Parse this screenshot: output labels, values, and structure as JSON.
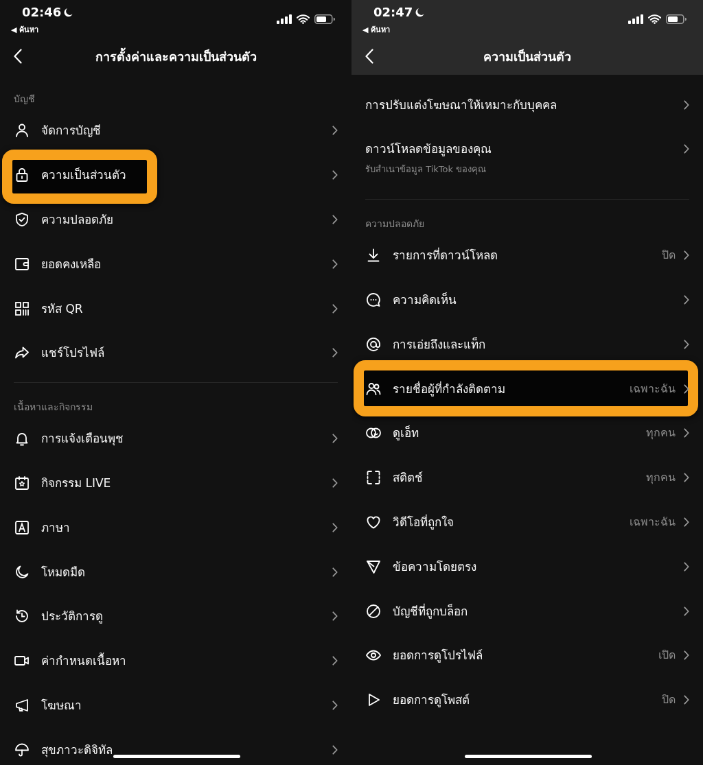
{
  "panels": [
    {
      "status_bar": {
        "time": "02:46",
        "back_link": "◀ ค้นหา"
      },
      "header": {
        "title": "การตั้งค่าและความเป็นส่วนตัว",
        "shaded": false
      },
      "sections": [
        {
          "title": "บัญชี",
          "items": [
            {
              "label": "จัดการบัญชี",
              "highlighted": false
            },
            {
              "label": "ความเป็นส่วนตัว",
              "highlighted": true
            },
            {
              "label": "ความปลอดภัย",
              "highlighted": false
            },
            {
              "label": "ยอดคงเหลือ",
              "highlighted": false
            },
            {
              "label": "รหัส QR",
              "highlighted": false
            },
            {
              "label": "แชร์โปรไฟล์",
              "highlighted": false
            }
          ]
        },
        {
          "title": "เนื้อหาและกิจกรรม",
          "items": [
            {
              "label": "การแจ้งเตือนพุช",
              "highlighted": false
            },
            {
              "label": "กิจกรรม LIVE",
              "highlighted": false
            },
            {
              "label": "ภาษา",
              "highlighted": false
            },
            {
              "label": "โหมดมืด",
              "highlighted": false
            },
            {
              "label": "ประวัติการดู",
              "highlighted": false
            },
            {
              "label": "ค่ากำหนดเนื้อหา",
              "highlighted": false
            },
            {
              "label": "โฆษณา",
              "highlighted": false
            },
            {
              "label": "สุขภาวะดิจิทัล",
              "highlighted": false
            }
          ]
        }
      ]
    },
    {
      "status_bar": {
        "time": "02:47",
        "back_link": "◀ ค้นหา"
      },
      "header": {
        "title": "ความเป็นส่วนตัว",
        "shaded": true
      },
      "sections": [
        {
          "items": [
            {
              "label": "การปรับแต่งโฆษณาให้เหมาะกับบุคคล",
              "highlighted": false
            },
            {
              "label": "ดาวน์โหลดข้อมูลของคุณ",
              "subtitle": "รับสำเนาข้อมูล TikTok ของคุณ",
              "highlighted": false
            }
          ]
        },
        {
          "title": "ความปลอดภัย",
          "items": [
            {
              "label": "รายการที่ดาวน์โหลด",
              "value": "ปิด",
              "highlighted": false
            },
            {
              "label": "ความคิดเห็น",
              "highlighted": false
            },
            {
              "label": "การเอ่ยถึงและแท็ก",
              "highlighted": false
            },
            {
              "label": "รายชื่อผู้ที่กำลังติดตาม",
              "value": "เฉพาะฉัน",
              "highlighted": true
            },
            {
              "label": "ดูเอ็ท",
              "value": "ทุกคน",
              "highlighted": false
            },
            {
              "label": "สติตช์",
              "value": "ทุกคน",
              "highlighted": false
            },
            {
              "label": "วิดีโอที่ถูกใจ",
              "value": "เฉพาะฉัน",
              "highlighted": false
            },
            {
              "label": "ข้อความโดยตรง",
              "highlighted": false
            },
            {
              "label": "บัญชีที่ถูกบล็อก",
              "highlighted": false
            },
            {
              "label": "ยอดการดูโปรไฟล์",
              "value": "เปิด",
              "highlighted": false
            },
            {
              "label": "ยอดการดูโพสต์",
              "value": "ปิด",
              "highlighted": false
            }
          ]
        }
      ]
    }
  ]
}
